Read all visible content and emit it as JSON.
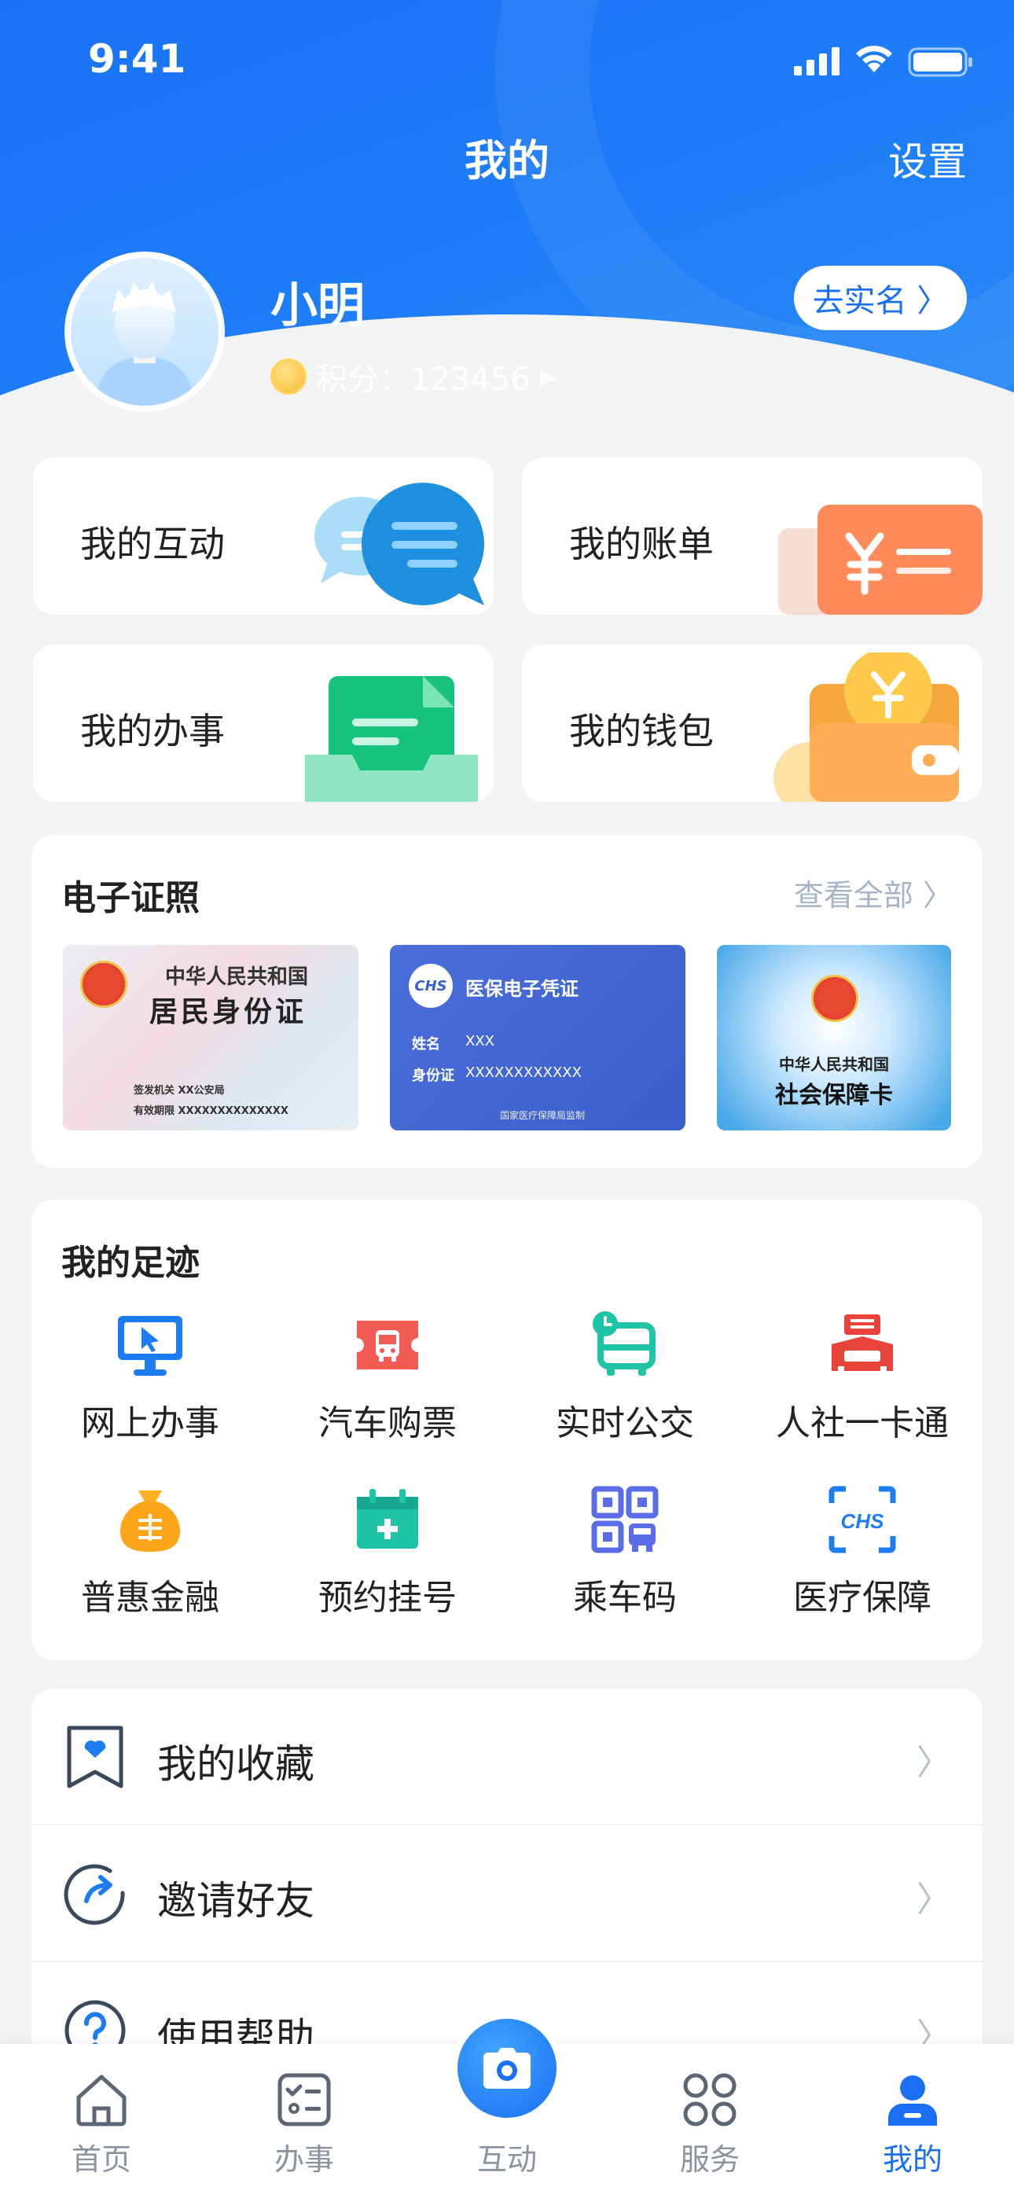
{
  "status_bar": {
    "time": "9:41"
  },
  "nav": {
    "title": "我的",
    "settings": "设置"
  },
  "profile": {
    "name": "小明",
    "points_label": "积分：123456",
    "realname_button": "去实名 〉"
  },
  "quick_cards": [
    {
      "label": "我的互动",
      "icon": "chat-bubbles-icon"
    },
    {
      "label": "我的账单",
      "icon": "bill-yuan-icon"
    },
    {
      "label": "我的办事",
      "icon": "document-tray-icon"
    },
    {
      "label": "我的钱包",
      "icon": "wallet-coin-icon"
    }
  ],
  "certificates": {
    "title": "电子证照",
    "more": "查看全部 〉",
    "id_card": {
      "line1": "中华人民共和国",
      "line2": "居民身份证",
      "issuer": "签发机关  XX公安局",
      "validity": "有效期限  XXXXXXXXXXXXXX"
    },
    "medical": {
      "logo": "CHS",
      "title": "医保电子凭证",
      "name_label": "姓名",
      "name_value": "XXX",
      "id_label": "身份证",
      "id_value": "XXXXXXXXXXXX",
      "footer": "国家医疗保障局监制"
    },
    "social": {
      "line1": "中华人民共和国",
      "line2": "社会保障卡"
    }
  },
  "footprints": {
    "title": "我的足迹",
    "items": [
      {
        "label": "网上办事",
        "icon": "monitor-icon"
      },
      {
        "label": "汽车购票",
        "icon": "bus-ticket-icon"
      },
      {
        "label": "实时公交",
        "icon": "bus-clock-icon"
      },
      {
        "label": "人社一卡通",
        "icon": "building-card-icon"
      },
      {
        "label": "普惠金融",
        "icon": "money-bag-icon"
      },
      {
        "label": "预约挂号",
        "icon": "medical-calendar-icon"
      },
      {
        "label": "乘车码",
        "icon": "qr-bus-icon"
      },
      {
        "label": "医疗保障",
        "icon": "chs-scan-icon"
      }
    ]
  },
  "list": [
    {
      "label": "我的收藏",
      "icon": "bookmark-heart-icon"
    },
    {
      "label": "邀请好友",
      "icon": "share-circle-icon"
    },
    {
      "label": "使用帮助",
      "icon": "help-icon"
    }
  ],
  "tabs": [
    {
      "label": "首页",
      "icon": "home-icon"
    },
    {
      "label": "办事",
      "icon": "checklist-icon"
    },
    {
      "label": "互动",
      "icon": "camera-icon"
    },
    {
      "label": "服务",
      "icon": "grid-icon"
    },
    {
      "label": "我的",
      "icon": "user-icon"
    }
  ],
  "colors": {
    "primary": "#1a6ff3",
    "header": "#1d7cf7",
    "background": "#f2f3f5",
    "tab_inactive": "#8a93a0"
  }
}
